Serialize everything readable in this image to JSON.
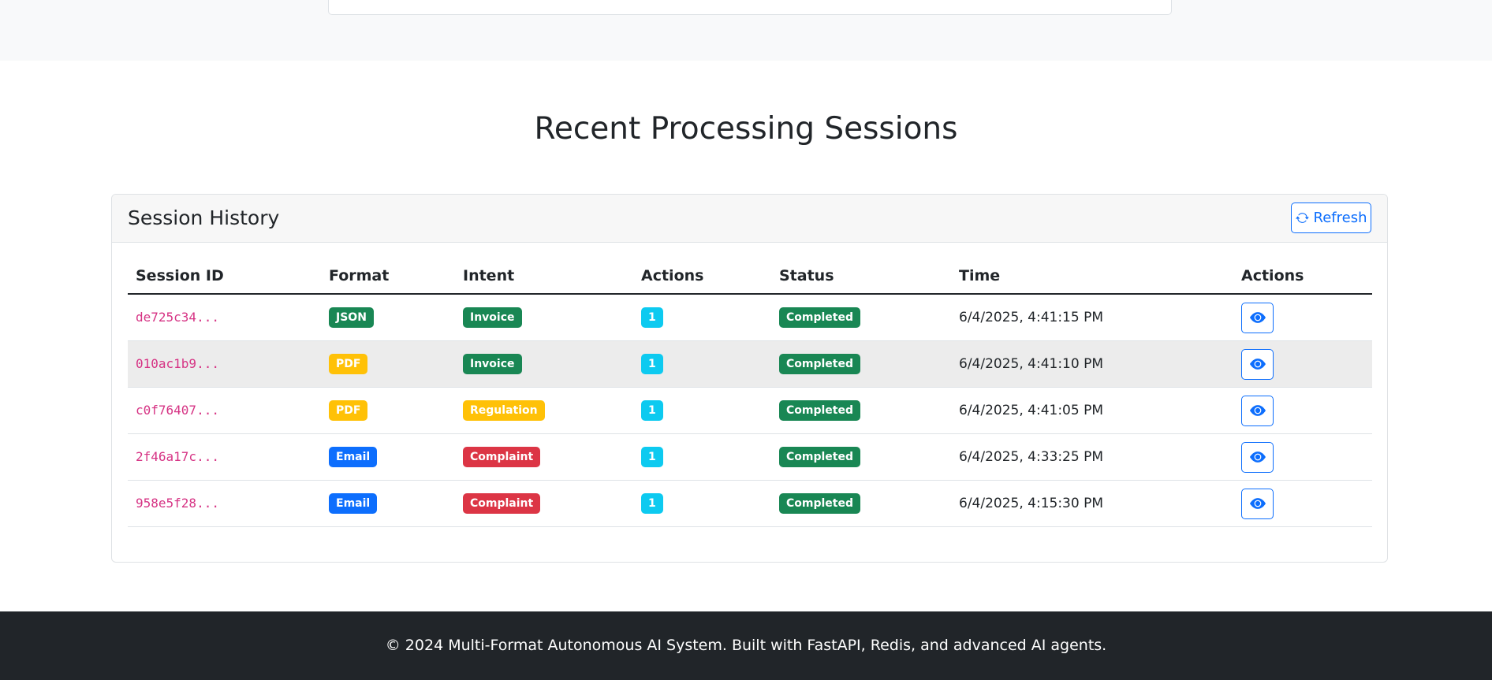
{
  "section": {
    "title": "Recent Processing Sessions"
  },
  "card": {
    "title": "Session History",
    "refresh_label": "Refresh"
  },
  "table": {
    "headers": [
      "Session ID",
      "Format",
      "Intent",
      "Actions",
      "Status",
      "Time",
      "Actions"
    ],
    "rows": [
      {
        "session_id": "de725c34...",
        "format": "JSON",
        "format_color": "#198754",
        "intent": "Invoice",
        "intent_color": "#198754",
        "actions": "1",
        "status": "Completed",
        "time": "6/4/2025, 4:41:15 PM"
      },
      {
        "session_id": "010ac1b9...",
        "format": "PDF",
        "format_color": "#ffc107",
        "intent": "Invoice",
        "intent_color": "#198754",
        "actions": "1",
        "status": "Completed",
        "time": "6/4/2025, 4:41:10 PM"
      },
      {
        "session_id": "c0f76407...",
        "format": "PDF",
        "format_color": "#ffc107",
        "intent": "Regulation",
        "intent_color": "#ffc107",
        "actions": "1",
        "status": "Completed",
        "time": "6/4/2025, 4:41:05 PM"
      },
      {
        "session_id": "2f46a17c...",
        "format": "Email",
        "format_color": "#0d6efd",
        "intent": "Complaint",
        "intent_color": "#dc3545",
        "actions": "1",
        "status": "Completed",
        "time": "6/4/2025, 4:33:25 PM"
      },
      {
        "session_id": "958e5f28...",
        "format": "Email",
        "format_color": "#0d6efd",
        "intent": "Complaint",
        "intent_color": "#dc3545",
        "actions": "1",
        "status": "Completed",
        "time": "6/4/2025, 4:15:30 PM"
      }
    ]
  },
  "colors": {
    "status_completed": "#198754",
    "actions_badge": "#0dcaf0",
    "accent": "#0d6efd",
    "footer_bg": "#212529"
  },
  "icons": {
    "refresh": "sync-icon",
    "view": "eye-icon"
  },
  "footer": {
    "text": "© 2024 Multi-Format Autonomous AI System. Built with FastAPI, Redis, and advanced AI agents."
  }
}
